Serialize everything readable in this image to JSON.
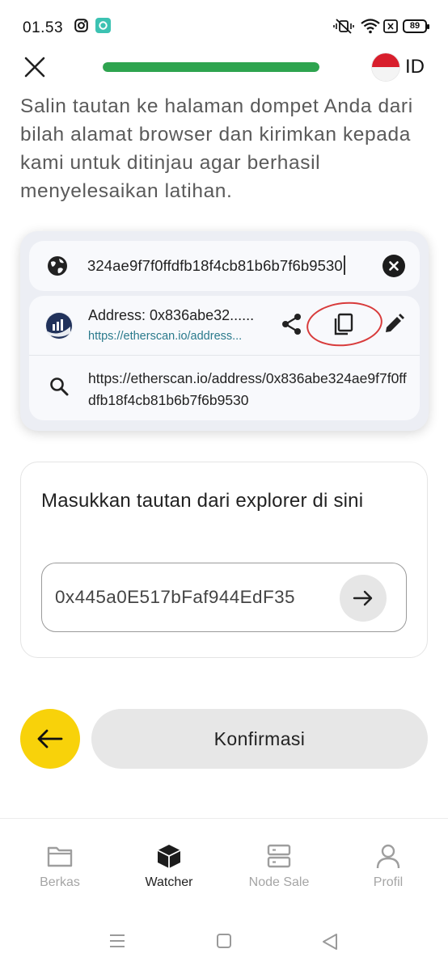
{
  "status_bar": {
    "time": "01.53",
    "battery": "89",
    "icons": [
      "instagram-icon",
      "app-notification-icon",
      "mute-vibrate-icon",
      "wifi-icon",
      "sim-icon",
      "battery-icon"
    ]
  },
  "header": {
    "close_icon": "close-icon",
    "progress_fraction": 1.0,
    "language_code": "ID"
  },
  "instruction": "Salin tautan ke halaman dompet Anda dari bilah alamat browser dan kirimkan kepada kami untuk ditinjau agar berhasil menyelesaikan latihan.",
  "illustration": {
    "url_bar_text": "324ae9f7f0ffdfb18f4cb81b6b7f6b9530",
    "suggestion_title": "Address: 0x836abe32......",
    "suggestion_url": "https://etherscan.io/address...",
    "search_suggestion": "https://etherscan.io/address/0x836abe324ae9f7f0ffdfb18f4cb81b6b7f6b9530",
    "highlight_color": "#d83b3b"
  },
  "link_form": {
    "label": "Masukkan tautan dari explorer di sini",
    "input_value": "0x445a0E517bFaf944EdF35"
  },
  "actions": {
    "confirm_label": "Konfirmasi",
    "back_color": "#f8d20a"
  },
  "bottom_nav": {
    "items": [
      {
        "label": "Berkas",
        "icon": "folder-icon",
        "active": false
      },
      {
        "label": "Watcher",
        "icon": "cube-icon",
        "active": true
      },
      {
        "label": "Node Sale",
        "icon": "server-icon",
        "active": false
      },
      {
        "label": "Profil",
        "icon": "user-icon",
        "active": false
      }
    ]
  },
  "colors": {
    "progress": "#2ea44f",
    "accent_yellow": "#f8d20a",
    "flag_red": "#d81e2c"
  }
}
